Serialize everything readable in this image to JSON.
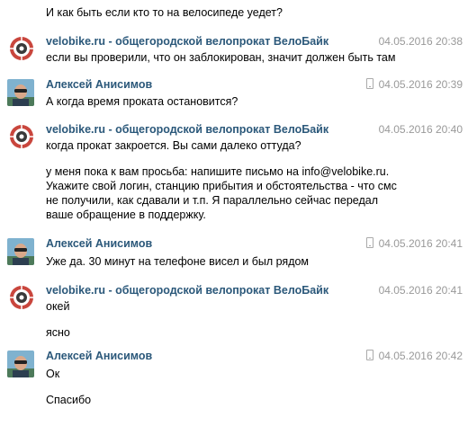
{
  "messages": [
    {
      "text": "И как быть если кто то на велосипеде уедет?"
    },
    {
      "sender": "velobike.ru - общегородской велопрокат ВелоБайк",
      "time": "04.05.2016 20:38",
      "lines": [
        "если вы проверили, что он заблокирован, значит должен быть там"
      ]
    },
    {
      "sender": "Алексей Анисимов",
      "time": "04.05.2016 20:39",
      "lines": [
        "А когда время проката остановится?"
      ]
    },
    {
      "sender": "velobike.ru - общегородской велопрокат ВелоБайк",
      "time": "04.05.2016 20:40",
      "lines": [
        "когда прокат закроется. Вы сами далеко оттуда?"
      ],
      "extra_lines": [
        "у меня пока к вам просьба: напишите письмо на info@velobike.ru.",
        "Укажите свой логин, станцию прибытия и обстоятельства - что смс",
        "не получили, как сдавали и т.п. Я параллельно сейчас передал",
        "ваше обращение в поддержку."
      ]
    },
    {
      "sender": "Алексей Анисимов",
      "time": "04.05.2016 20:41",
      "lines": [
        "Уже да. 30 минут на телефоне висел и был рядом"
      ]
    },
    {
      "sender": "velobike.ru - общегородской велопрокат ВелоБайк",
      "time": "04.05.2016 20:41",
      "lines": [
        "окей"
      ],
      "extra_lines": [
        "ясно"
      ]
    },
    {
      "sender": "Алексей Анисимов",
      "time": "04.05.2016 20:42",
      "lines": [
        "Ок"
      ],
      "extra_lines": [
        "Спасибо"
      ]
    }
  ]
}
